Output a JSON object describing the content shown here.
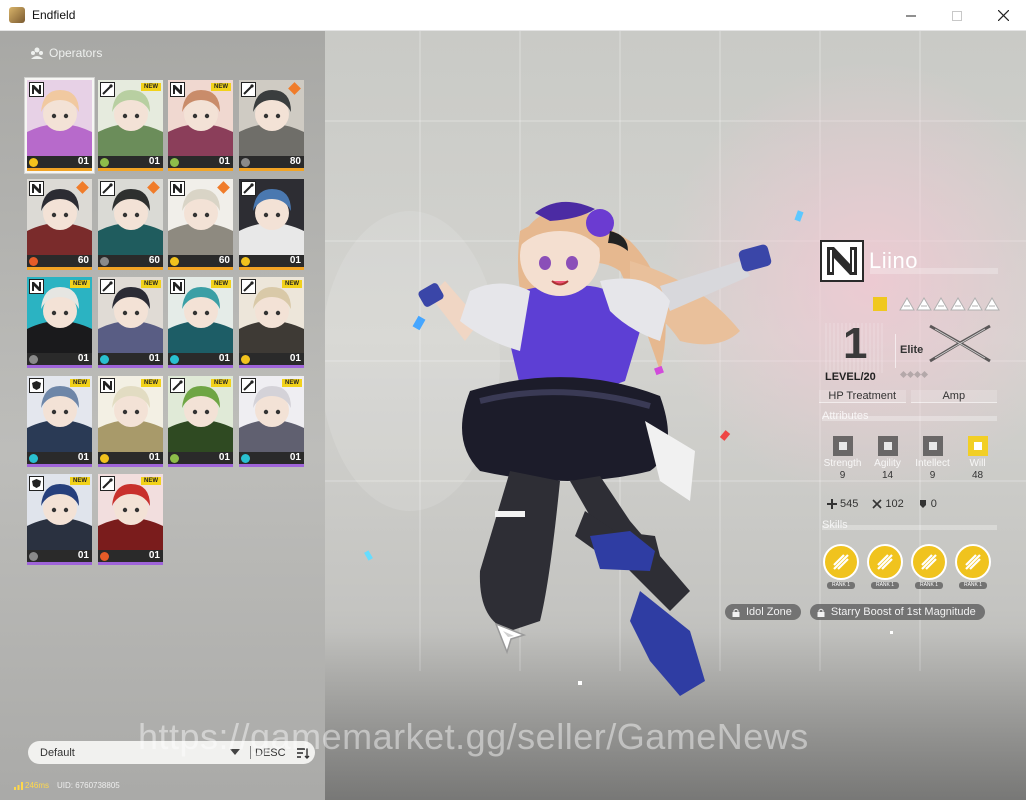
{
  "window": {
    "title": "Endfield",
    "minimize_label": "Minimize",
    "maximize_label": "Maximize",
    "close_label": "Close"
  },
  "panel": {
    "title": "Operators"
  },
  "operators": [
    {
      "level": "01",
      "new": false,
      "orange": false,
      "selected": true,
      "palette": [
        "#f1c9a0",
        "#b76acb",
        "#e7d1e6"
      ],
      "element_color": "#f2c21d",
      "rarity_color": "#f2a425",
      "class_icon": "guard-icon"
    },
    {
      "level": "01",
      "new": true,
      "orange": false,
      "selected": false,
      "palette": [
        "#b8cfa1",
        "#6b8d5a",
        "#e6ebde"
      ],
      "element_color": "#8dbd4a",
      "rarity_color": "#f2a425",
      "class_icon": "caster-icon"
    },
    {
      "level": "01",
      "new": true,
      "orange": false,
      "selected": false,
      "palette": [
        "#c98c6a",
        "#8b3e5a",
        "#f0d8d0"
      ],
      "element_color": "#8dbd4a",
      "rarity_color": "#f2a425",
      "class_icon": "guard-icon"
    },
    {
      "level": "80",
      "new": false,
      "orange": true,
      "selected": false,
      "palette": [
        "#3a3d3e",
        "#6f6e69",
        "#cfcbc3"
      ],
      "element_color": "#8a8a8a",
      "rarity_color": "#f2a425",
      "class_icon": "caster-icon"
    },
    {
      "level": "60",
      "new": false,
      "orange": true,
      "selected": false,
      "palette": [
        "#2c2c33",
        "#7a2b2b",
        "#dcdad5"
      ],
      "element_color": "#e55c28",
      "rarity_color": "#f2a425",
      "class_icon": "guard-icon"
    },
    {
      "level": "60",
      "new": false,
      "orange": true,
      "selected": false,
      "palette": [
        "#2e302f",
        "#1f5c5e",
        "#dadad5"
      ],
      "element_color": "#8a8a8a",
      "rarity_color": "#f2a425",
      "class_icon": "caster-icon"
    },
    {
      "level": "60",
      "new": false,
      "orange": true,
      "selected": false,
      "palette": [
        "#d9d4c6",
        "#8e8a80",
        "#f1efea"
      ],
      "element_color": "#f2c21d",
      "rarity_color": "#f2a425",
      "class_icon": "guard-icon"
    },
    {
      "level": "01",
      "new": false,
      "orange": false,
      "selected": false,
      "palette": [
        "#4a78b0",
        "#e8e8e8",
        "#2d2d33"
      ],
      "element_color": "#f2c21d",
      "rarity_color": "#f2a425",
      "class_icon": "caster-icon"
    },
    {
      "level": "01",
      "new": true,
      "orange": false,
      "selected": false,
      "palette": [
        "#e6e6e2",
        "#1a1a1c",
        "#2bb3c2"
      ],
      "element_color": "#8a8a8a",
      "rarity_color": "#9f64d9",
      "class_icon": "guard-icon"
    },
    {
      "level": "01",
      "new": true,
      "orange": false,
      "selected": false,
      "palette": [
        "#2b2b35",
        "#595d84",
        "#e0dbd5"
      ],
      "element_color": "#29c0d0",
      "rarity_color": "#9f64d9",
      "class_icon": "caster-icon"
    },
    {
      "level": "01",
      "new": true,
      "orange": false,
      "selected": false,
      "palette": [
        "#3b9fa5",
        "#1d5d66",
        "#e5ece8"
      ],
      "element_color": "#29c0d0",
      "rarity_color": "#9f64d9",
      "class_icon": "guard-icon"
    },
    {
      "level": "01",
      "new": true,
      "orange": false,
      "selected": false,
      "palette": [
        "#d9c9a8",
        "#3e3a35",
        "#ede6da"
      ],
      "element_color": "#f2c21d",
      "rarity_color": "#9f64d9",
      "class_icon": "caster-icon"
    },
    {
      "level": "01",
      "new": true,
      "orange": false,
      "selected": false,
      "palette": [
        "#6e86a8",
        "#2a3a55",
        "#e4e7ee"
      ],
      "element_color": "#29c0d0",
      "rarity_color": "#9f64d9",
      "class_icon": "defender-icon"
    },
    {
      "level": "01",
      "new": true,
      "orange": false,
      "selected": false,
      "palette": [
        "#e2dcc2",
        "#a89a6a",
        "#f3f0e4"
      ],
      "element_color": "#f2c21d",
      "rarity_color": "#9f64d9",
      "class_icon": "guard-icon"
    },
    {
      "level": "01",
      "new": true,
      "orange": false,
      "selected": false,
      "palette": [
        "#6fa544",
        "#2f4a22",
        "#e0ead7"
      ],
      "element_color": "#8dbd4a",
      "rarity_color": "#9f64d9",
      "class_icon": "caster-icon"
    },
    {
      "level": "01",
      "new": true,
      "orange": false,
      "selected": false,
      "palette": [
        "#d4d2d8",
        "#606070",
        "#efeef2"
      ],
      "element_color": "#29c0d0",
      "rarity_color": "#9f64d9",
      "class_icon": "caster-icon"
    },
    {
      "level": "01",
      "new": true,
      "orange": false,
      "selected": false,
      "palette": [
        "#263f7c",
        "#2a3140",
        "#e0e4ec"
      ],
      "element_color": "#8a8a8a",
      "rarity_color": "#9f64d9",
      "class_icon": "defender-icon"
    },
    {
      "level": "01",
      "new": true,
      "orange": false,
      "selected": false,
      "palette": [
        "#c8302c",
        "#7a1c1c",
        "#f2dede"
      ],
      "element_color": "#e55c28",
      "rarity_color": "#9f64d9",
      "class_icon": "caster-icon"
    }
  ],
  "sort": {
    "selected": "Default",
    "order": "DESC"
  },
  "status": {
    "ping": "246ms",
    "uid": "UID: 6760738805"
  },
  "selected_operator": {
    "name": "Liino",
    "level": "1",
    "level_label": "LEVEL/20",
    "elite_label": "Elite",
    "rarity_stars": 6,
    "tags": [
      "HP Treatment",
      "Amp"
    ],
    "attributes_header": "Attributes",
    "attributes": [
      {
        "name": "Strength",
        "value": "9",
        "icon": "strength-icon",
        "highlight": false
      },
      {
        "name": "Agility",
        "value": "14",
        "icon": "agility-icon",
        "highlight": false
      },
      {
        "name": "Intellect",
        "value": "9",
        "icon": "intellect-icon",
        "highlight": false
      },
      {
        "name": "Will",
        "value": "48",
        "icon": "will-icon",
        "highlight": true
      }
    ],
    "stats": [
      {
        "value": "545",
        "icon": "hp-icon"
      },
      {
        "value": "102",
        "icon": "attack-icon"
      },
      {
        "value": "0",
        "icon": "defense-icon"
      }
    ],
    "skills_header": "Skills",
    "skills": [
      {
        "rank": "RANK 1",
        "icon": "skill-basic-icon"
      },
      {
        "rank": "RANK 1",
        "icon": "skill-battle-icon"
      },
      {
        "rank": "RANK 1",
        "icon": "skill-combo-icon"
      },
      {
        "rank": "RANK 1",
        "icon": "skill-ultimate-icon"
      }
    ],
    "talents": [
      "Idol Zone",
      "Starry Boost of 1st Magnitude"
    ]
  },
  "watermark": "https://gamemarket.gg/seller/GameNews",
  "colors": {
    "accent_yellow": "#f2c21d",
    "rarity_gold": "#f2a425",
    "rarity_purple": "#9f64d9",
    "new_badge": "#f2d21a",
    "orange_marker": "#f07c2a"
  }
}
